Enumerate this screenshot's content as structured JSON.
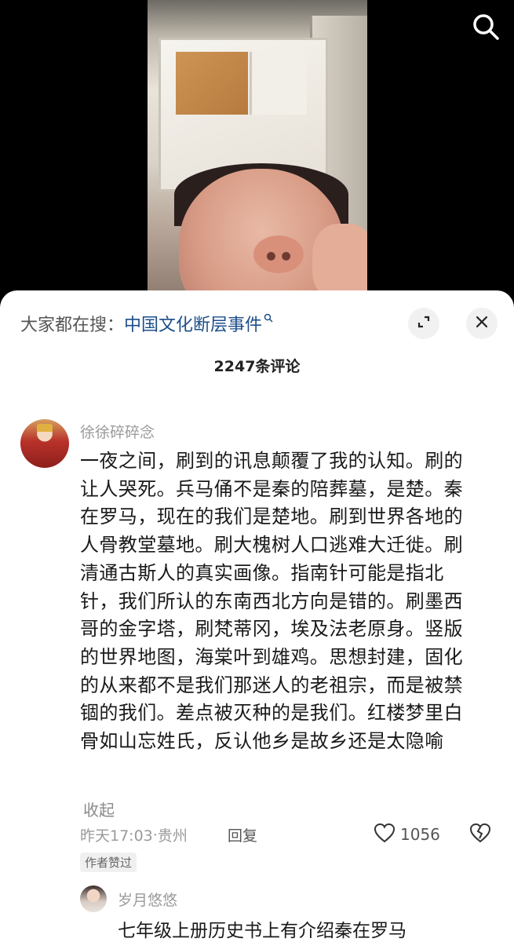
{
  "video": {
    "search_icon": "search-icon"
  },
  "sheet": {
    "suggest_label": "大家都在搜：",
    "suggest_query": "中国文化断层事件",
    "expand_icon": "expand-icon",
    "close_icon": "close-icon",
    "comment_count": "2247条评论"
  },
  "comment": {
    "username": "徐徐碎碎念",
    "lines": [
      "一夜之间，刷到的讯息颠覆了我的认知。刷的",
      "让人哭死。兵马俑不是秦的陪葬墓，是楚。秦",
      "在罗马，现在的我们是楚地。刷到世界各地的",
      "人骨教堂墓地。刷大槐树人口逃难大迁徙。刷",
      "清通古斯人的真实画像。指南针可能是指北",
      "针，我们所认的东南西北方向是错的。刷墨西",
      "哥的金字塔，刷梵蒂冈，埃及法老原身。竖版",
      "的世界地图，海棠叶到雄鸡。思想封建，固化",
      "的从来都不是我们那迷人的老祖宗，而是被禁",
      "锢的我们。差点被灭种的是我们。红楼梦里白",
      "骨如山忘姓氏，反认他乡是故乡还是太隐喻"
    ],
    "collapse_label": "收起",
    "time": "昨天17:03",
    "location": "贵州",
    "reply_label": "回复",
    "like_count": "1056",
    "author_badge": "作者赞过"
  },
  "reply": {
    "username": "岁月悠悠",
    "text": "七年级上册历史书上有介绍秦在罗马"
  }
}
